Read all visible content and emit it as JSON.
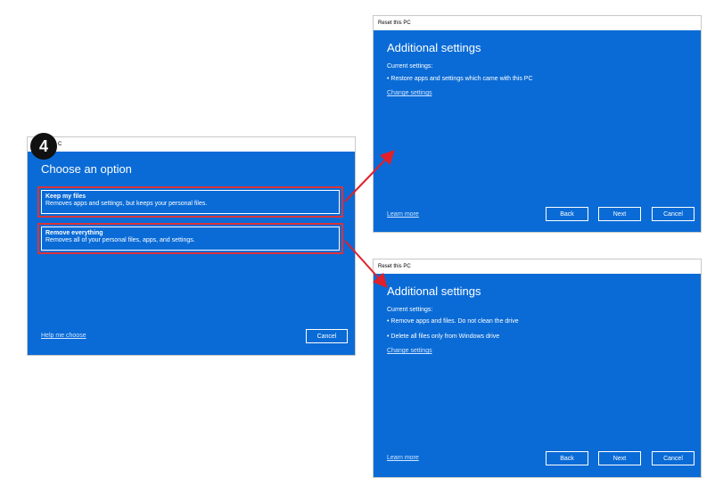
{
  "step_number": "4",
  "choose_window": {
    "titlebar": "C",
    "title": "Choose an option",
    "options": [
      {
        "title": "Keep my files",
        "description": "Removes apps and settings, but keeps your personal files."
      },
      {
        "title": "Remove everything",
        "description": "Removes all of your personal files, apps, and settings."
      }
    ],
    "help_link": "Help me choose",
    "cancel_label": "Cancel"
  },
  "keep_files_window": {
    "titlebar": "Reset this PC",
    "title": "Additional settings",
    "current_label": "Current settings:",
    "settings": [
      "•  Restore apps and settings which came with this PC"
    ],
    "change_link": "Change settings",
    "learn_more": "Learn more",
    "back_label": "Back",
    "next_label": "Next",
    "cancel_label": "Cancel"
  },
  "remove_everything_window": {
    "titlebar": "Reset this PC",
    "title": "Additional settings",
    "current_label": "Current settings:",
    "settings": [
      "•  Remove apps and files. Do not clean the drive",
      "•  Delete all files only from Windows drive"
    ],
    "change_link": "Change settings",
    "learn_more": "Learn more",
    "back_label": "Back",
    "next_label": "Next",
    "cancel_label": "Cancel"
  },
  "colors": {
    "window_blue": "#0a6bd6",
    "highlight_red": "#d9343a",
    "arrow_red": "#e0202a"
  }
}
